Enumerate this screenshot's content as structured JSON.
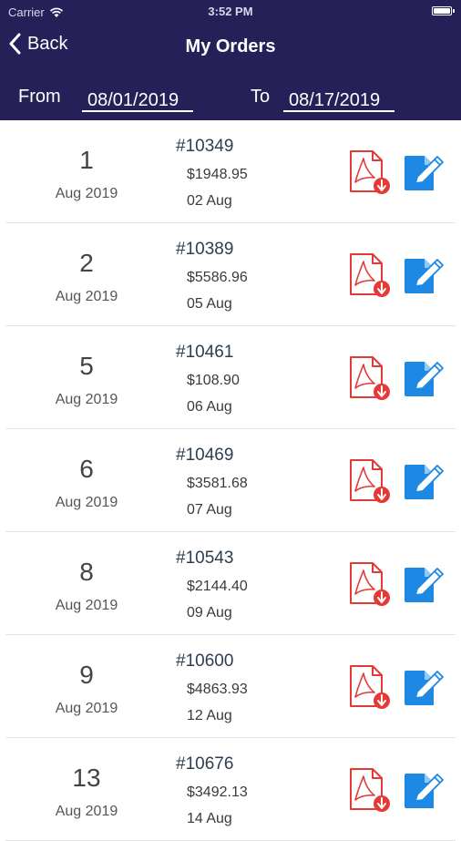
{
  "status_bar": {
    "carrier": "Carrier",
    "time": "3:52 PM"
  },
  "nav": {
    "back_label": "Back",
    "title": "My Orders"
  },
  "filter": {
    "from_label": "From",
    "from_value": "08/01/2019",
    "to_label": "To",
    "to_value": "08/17/2019"
  },
  "orders": [
    {
      "day": "1",
      "month_year": "Aug 2019",
      "order_no": "#10349",
      "amount": "$1948.95",
      "date": "02 Aug"
    },
    {
      "day": "2",
      "month_year": "Aug 2019",
      "order_no": "#10389",
      "amount": "$5586.96",
      "date": "05 Aug"
    },
    {
      "day": "5",
      "month_year": "Aug 2019",
      "order_no": "#10461",
      "amount": "$108.90",
      "date": "06 Aug"
    },
    {
      "day": "6",
      "month_year": "Aug 2019",
      "order_no": "#10469",
      "amount": "$3581.68",
      "date": "07 Aug"
    },
    {
      "day": "8",
      "month_year": "Aug 2019",
      "order_no": "#10543",
      "amount": "$2144.40",
      "date": "09 Aug"
    },
    {
      "day": "9",
      "month_year": "Aug 2019",
      "order_no": "#10600",
      "amount": "$4863.93",
      "date": "12 Aug"
    },
    {
      "day": "13",
      "month_year": "Aug 2019",
      "order_no": "#10676",
      "amount": "$3492.13",
      "date": "14 Aug"
    }
  ],
  "icons": {
    "pdf": "pdf-download-icon",
    "edit": "edit-document-icon",
    "back": "chevron-left-icon",
    "wifi": "wifi-icon",
    "battery": "battery-icon"
  },
  "colors": {
    "header_bg": "#262059",
    "pdf_red": "#e53935",
    "edit_blue": "#1e88e5"
  }
}
